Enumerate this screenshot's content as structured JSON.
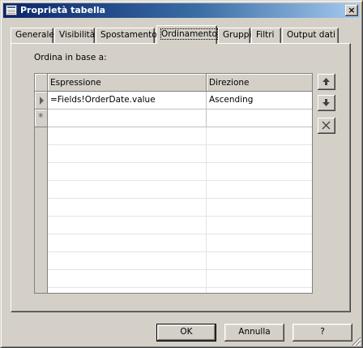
{
  "window": {
    "title": "Proprietà tabella",
    "close_label": "×"
  },
  "tabs": [
    {
      "label": "Generale",
      "active": false
    },
    {
      "label": "Visibilità",
      "active": false
    },
    {
      "label": "Spostamento",
      "active": false
    },
    {
      "label": "Ordinamento",
      "active": true
    },
    {
      "label": "Gruppi",
      "active": false
    },
    {
      "label": "Filtri",
      "active": false
    },
    {
      "label": "Output dati",
      "active": false
    }
  ],
  "sort": {
    "label": "Ordina in base a:",
    "columns": [
      "Espressione",
      "Direzione"
    ],
    "rows": [
      {
        "expression": "=Fields!OrderDate.value",
        "direction": "Ascending"
      }
    ],
    "new_row_marker": "*"
  },
  "side_buttons": [
    {
      "icon": "move-up-icon"
    },
    {
      "icon": "move-down-icon"
    },
    {
      "icon": "delete-icon"
    }
  ],
  "footer": {
    "ok_label": "OK",
    "cancel_label": "Annulla",
    "help_label": "?"
  }
}
